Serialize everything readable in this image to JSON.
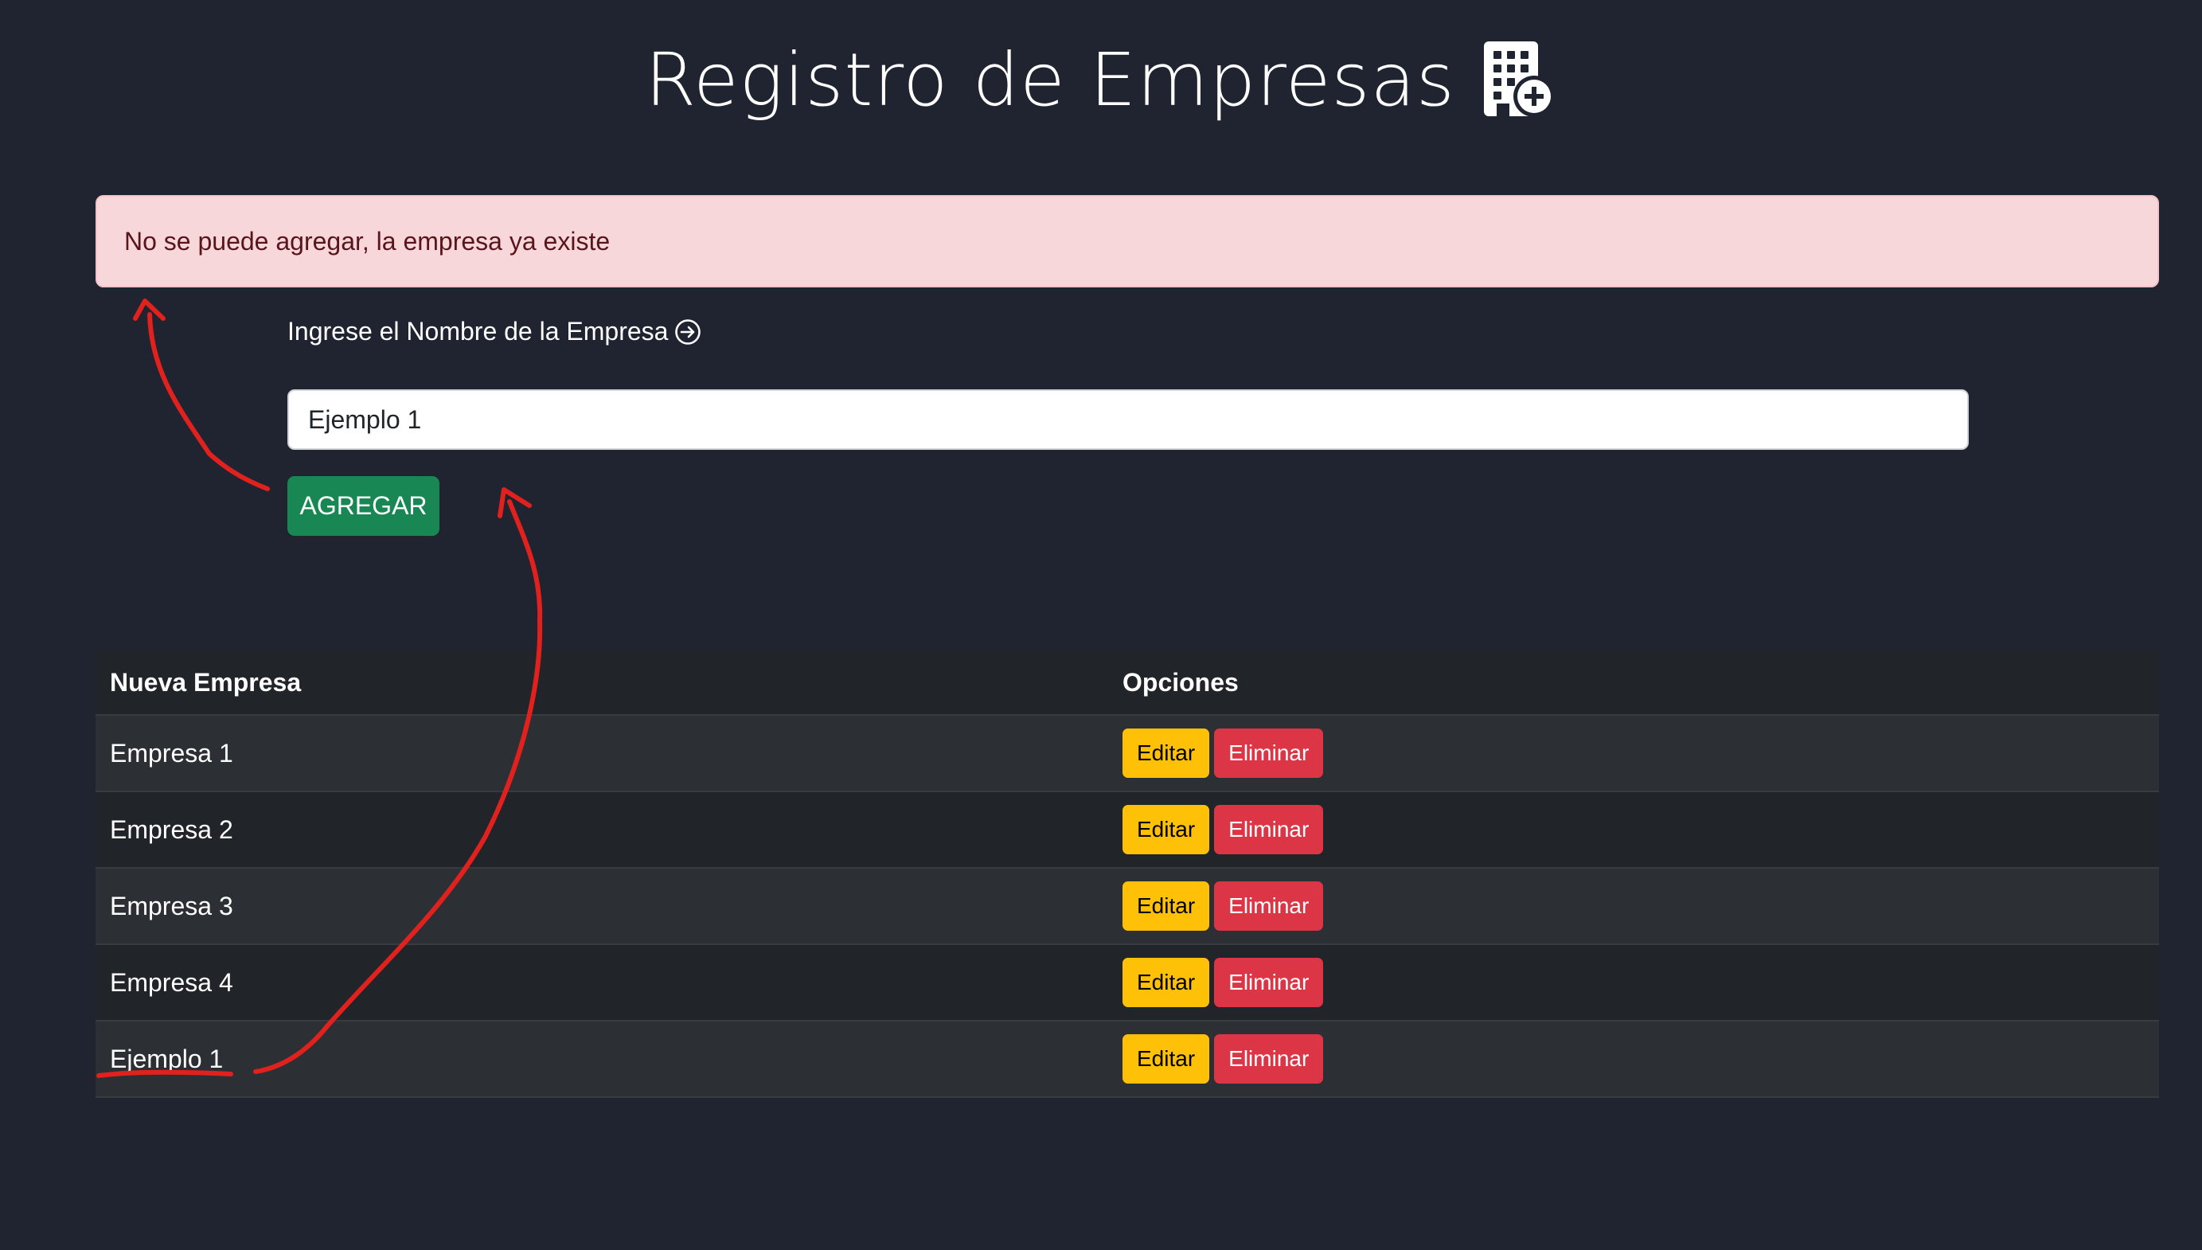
{
  "header": {
    "title": "Registro de Empresas",
    "icon": "building-add-icon"
  },
  "alert": {
    "message": "No se puede agregar, la empresa ya existe",
    "type": "danger"
  },
  "form": {
    "label": "Ingrese el Nombre de la Empresa",
    "label_icon": "arrow-right-circle-icon",
    "input_value": "Ejemplo 1",
    "submit_label": "AGREGAR"
  },
  "table": {
    "headers": [
      "Nueva Empresa",
      "Opciones"
    ],
    "edit_label": "Editar",
    "delete_label": "Eliminar",
    "rows": [
      {
        "name": "Empresa 1"
      },
      {
        "name": "Empresa 2"
      },
      {
        "name": "Empresa 3"
      },
      {
        "name": "Empresa 4"
      },
      {
        "name": "Ejemplo 1"
      }
    ]
  },
  "colors": {
    "background": "#1f2430",
    "alert_bg": "#f8d7da",
    "alert_text": "#58151c",
    "success": "#198754",
    "warning": "#ffc107",
    "danger": "#dc3545",
    "annotation": "#e0211d"
  }
}
